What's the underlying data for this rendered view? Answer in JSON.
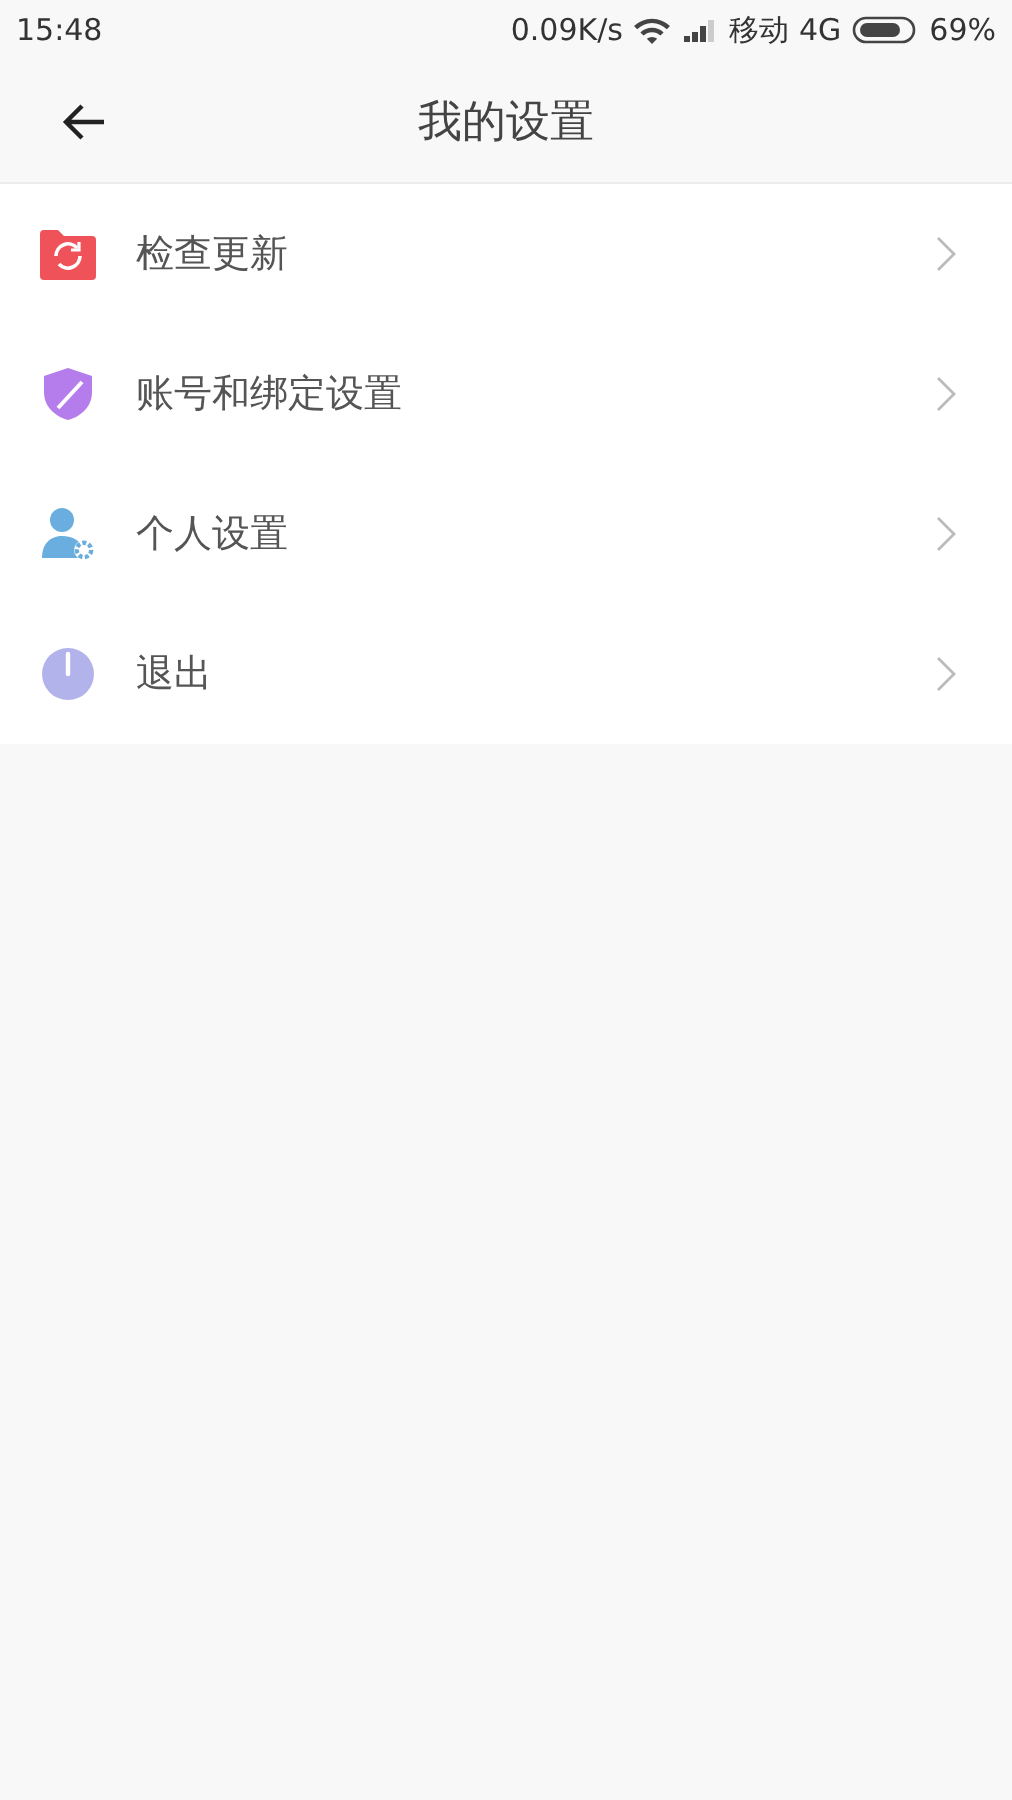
{
  "status_bar": {
    "time": "15:48",
    "speed": "0.09K/s",
    "carrier": "移动",
    "network": "4G",
    "battery": "69%"
  },
  "header": {
    "title": "我的设置"
  },
  "menu": [
    {
      "kind": "update",
      "label": "检查更新"
    },
    {
      "kind": "shield",
      "label": "账号和绑定设置"
    },
    {
      "kind": "user",
      "label": "个人设置"
    },
    {
      "kind": "power",
      "label": "退出"
    }
  ]
}
